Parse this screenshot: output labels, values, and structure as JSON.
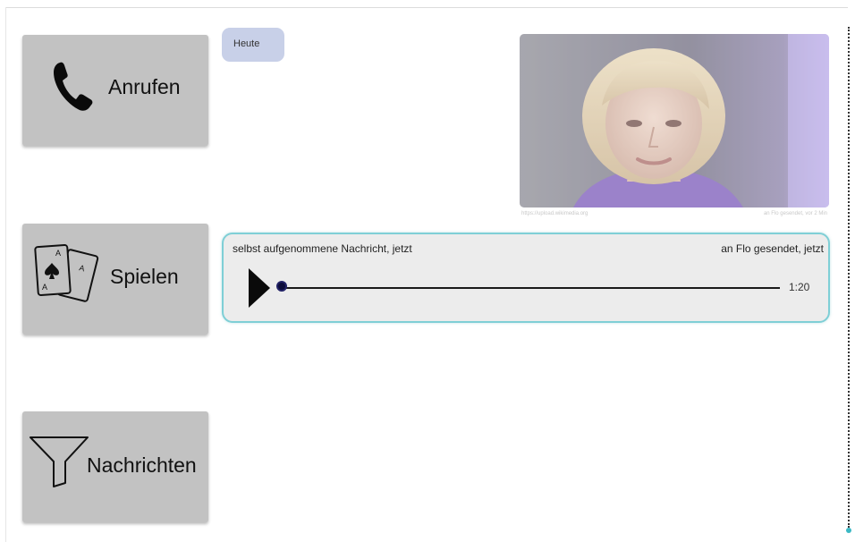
{
  "sidebar": {
    "call_label": "Anrufen",
    "play_label": "Spielen",
    "messages_label": "Nachrichten"
  },
  "chat": {
    "date_chip": "Heute",
    "photo_message": {
      "caption_left": "https://upload.wikimedia.org",
      "caption_right": "an Flo gesendet, vor 2 Min"
    },
    "audio_message": {
      "meta_left": "selbst aufgenommene Nachricht, jetzt",
      "meta_right": "an Flo gesendet, jetzt",
      "duration": "1:20",
      "progress": 0
    }
  },
  "icons": {
    "call": "phone-icon",
    "play": "playing-cards-icon",
    "messages": "filter-funnel-icon",
    "audio_play": "play-icon"
  },
  "colors": {
    "button_bg": "#c2c2c2",
    "date_chip_bg": "#c8d0e8",
    "audio_border": "#7fcfd6",
    "audio_bg": "#ececec",
    "scroll_end_dot": "#3bb8c4"
  }
}
